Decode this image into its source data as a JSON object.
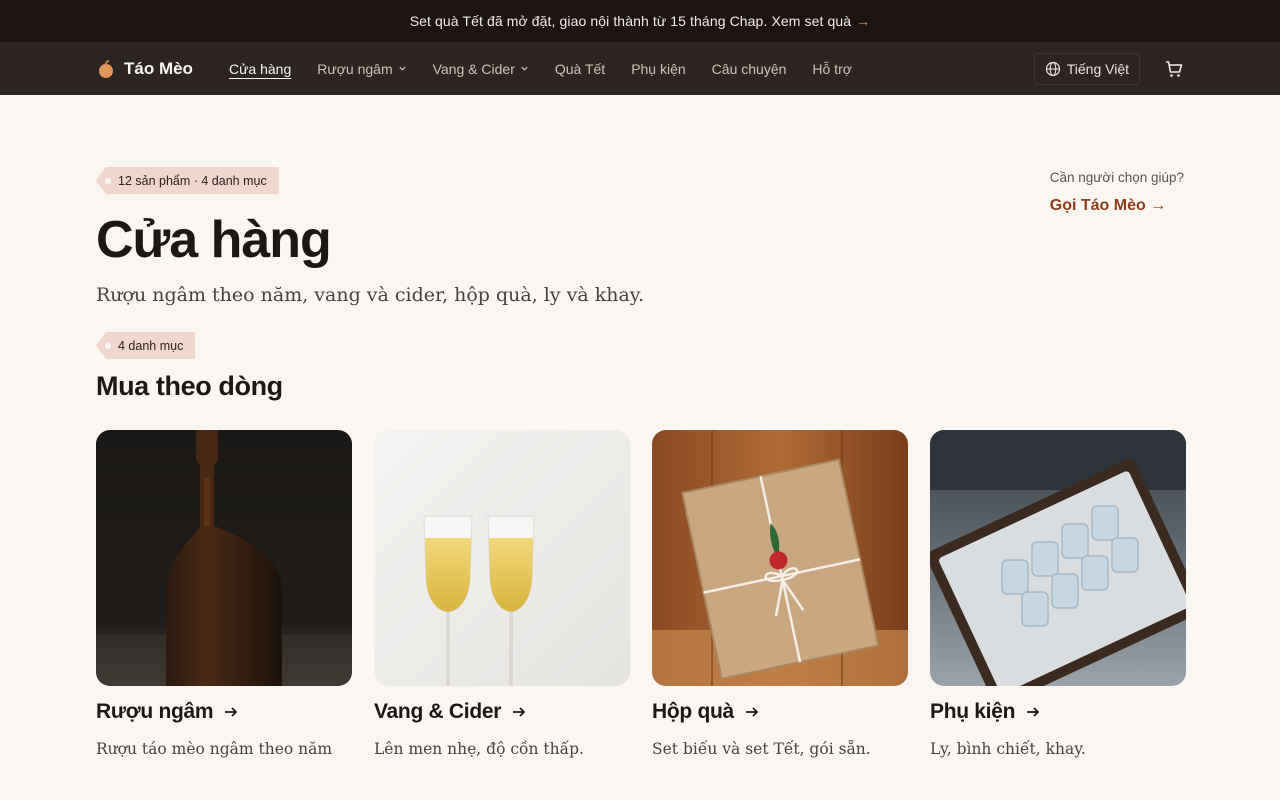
{
  "announcement": {
    "text": "Set quà Tết đã mở đặt, giao nội thành từ 15 tháng Chap.",
    "link": "Xem set quà",
    "arrow": "→"
  },
  "header": {
    "brand": "Táo Mèo",
    "nav": [
      {
        "label": "Cửa hàng",
        "active": true
      },
      {
        "label": "Rượu ngâm",
        "dropdown": true
      },
      {
        "label": "Vang & Cider",
        "dropdown": true
      },
      {
        "label": "Quà Tết"
      },
      {
        "label": "Phụ kiện"
      },
      {
        "label": "Câu chuyện"
      },
      {
        "label": "Hỗ trợ"
      }
    ],
    "language": "Tiếng Việt"
  },
  "hero": {
    "tag": "12 sản phẩm · 4 danh mục",
    "title": "Cửa hàng",
    "subtitle": "Rượu ngâm theo năm, vang và cider, hộp quà, ly và khay.",
    "help_question": "Cần người chọn giúp?",
    "help_cta": "Gọi Táo Mèo →"
  },
  "categories": {
    "tag": "4 danh mục",
    "heading": "Mua theo dòng",
    "items": [
      {
        "title": "Rượu ngâm",
        "desc": "Rượu táo mèo ngâm theo năm"
      },
      {
        "title": "Vang & Cider",
        "desc": "Lên men nhẹ, độ cồn thấp."
      },
      {
        "title": "Hộp quà",
        "desc": "Set biếu và set Tết, gói sẵn."
      },
      {
        "title": "Phụ kiện",
        "desc": "Ly, bình chiết, khay."
      }
    ]
  },
  "colors": {
    "announcement_bg": "#1b1411",
    "header_bg": "#2d2522",
    "page_bg": "#faf7f2",
    "accent": "#8b3d1e",
    "tag_bg": "#efd7cf"
  }
}
